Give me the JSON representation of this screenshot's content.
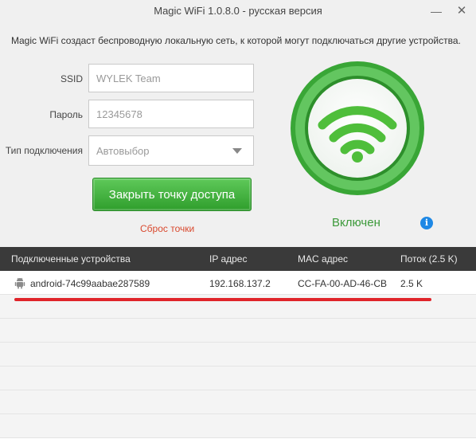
{
  "window": {
    "title": "Magic WiFi  1.0.8.0 - русская версия",
    "minimize_glyph": "—",
    "close_glyph": "✕"
  },
  "description": "Magic WiFi создаст беспроводную локальную сеть, к которой могут подключаться другие устройства.",
  "form": {
    "ssid_label": "SSID",
    "ssid_value": "WYLEK Team",
    "password_label": "Пароль",
    "password_value": "12345678",
    "connection_type_label": "Тип подключения",
    "connection_type_value": "Автовыбор"
  },
  "actions": {
    "close_access_point": "Закрыть точку доступа",
    "reset_point": "Сброс точки"
  },
  "status": {
    "label": "Включен",
    "info_glyph": "i",
    "icon": "wifi-icon",
    "accent_color": "#2fa12c"
  },
  "table": {
    "headers": [
      "Подключенные устройства",
      "IP адрес",
      "MAC адрес",
      "Поток (2.5 K)"
    ],
    "rows": [
      {
        "icon": "android-icon",
        "device": "android-74c99aabae287589",
        "ip": "192.168.137.2",
        "mac": "CC-FA-00-AD-46-CB",
        "flow": "2.5 K"
      }
    ]
  }
}
